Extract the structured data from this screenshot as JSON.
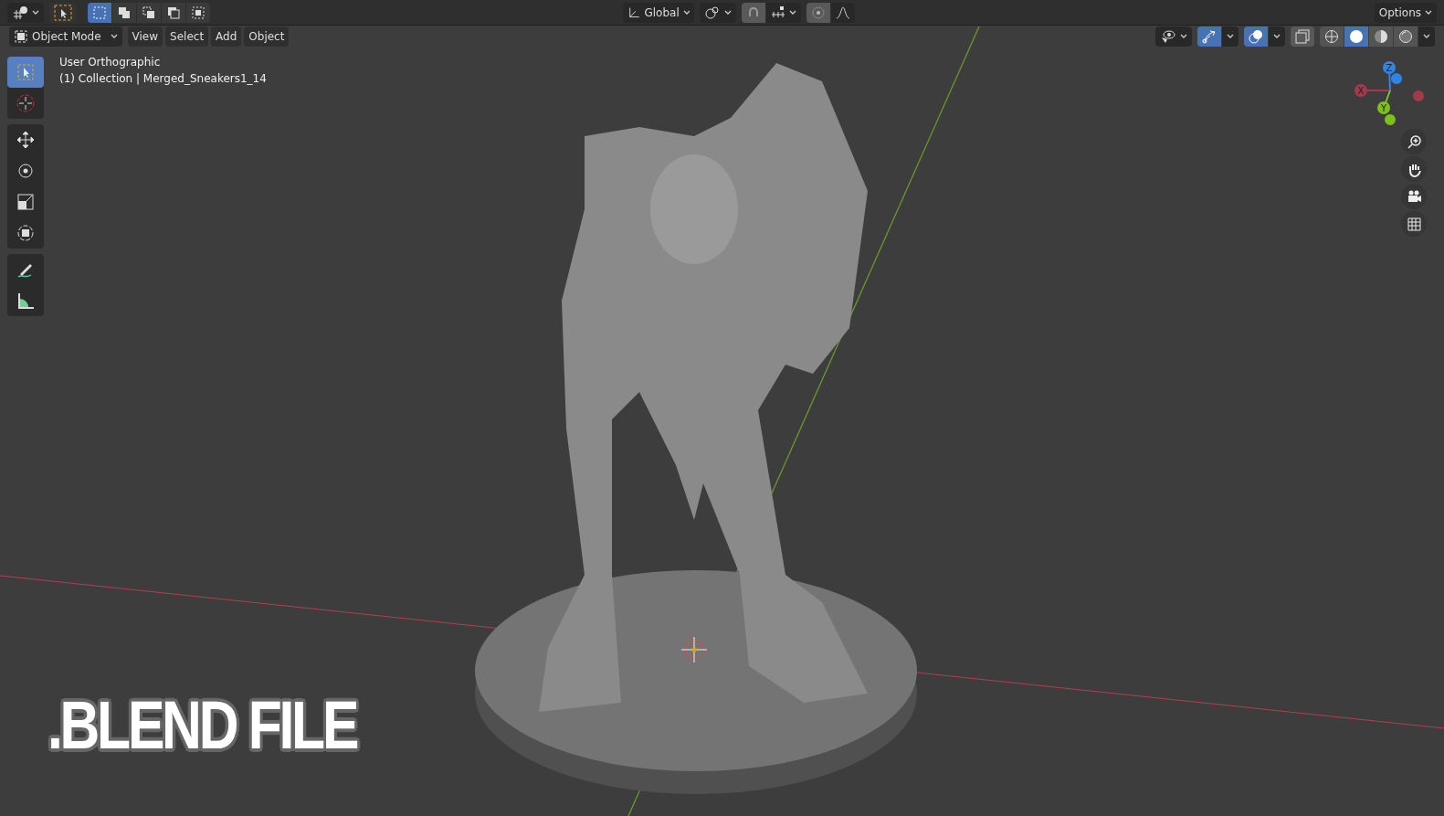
{
  "top_bar": {
    "select_modes": [
      {
        "selected": true
      },
      {
        "selected": false
      },
      {
        "selected": false
      },
      {
        "selected": false
      },
      {
        "selected": false
      }
    ],
    "transform_orientation": "Global",
    "options": "Options"
  },
  "header": {
    "mode": "Object Mode",
    "menus": [
      "View",
      "Select",
      "Add",
      "Object"
    ],
    "overlays_on": true,
    "gizmos_on": true,
    "shading": [
      {
        "kind": "wireframe",
        "selected": false
      },
      {
        "kind": "solid",
        "selected": true
      },
      {
        "kind": "material",
        "selected": false
      },
      {
        "kind": "rendered",
        "selected": false
      }
    ]
  },
  "viewport_info": [
    "User Orthographic",
    "(1) Collection | Merged_Sneakers1_14"
  ],
  "toolbar": {
    "groups": [
      {
        "tools": [
          {
            "kind": "select_box",
            "selected": true
          },
          {
            "kind": "cursor",
            "selected": false
          }
        ]
      },
      {
        "tools": [
          {
            "kind": "move",
            "selected": false
          },
          {
            "kind": "rotate",
            "selected": false
          },
          {
            "kind": "scale",
            "selected": false
          },
          {
            "kind": "transform",
            "selected": false
          }
        ]
      },
      {
        "tools": [
          {
            "kind": "annotate",
            "selected": false
          },
          {
            "kind": "measure",
            "selected": false
          }
        ]
      }
    ]
  },
  "gizmo": {
    "axes": [
      {
        "label": "Z",
        "color": "#2f84e6"
      },
      {
        "label": "X",
        "color": "#a33a4b"
      },
      {
        "label": "Y",
        "color": "#7cc11a"
      }
    ]
  },
  "navigation": [
    {
      "kind": "zoom"
    },
    {
      "kind": "pan"
    },
    {
      "kind": "camera"
    },
    {
      "kind": "ortho"
    }
  ],
  "label": ".BLEND FILE"
}
